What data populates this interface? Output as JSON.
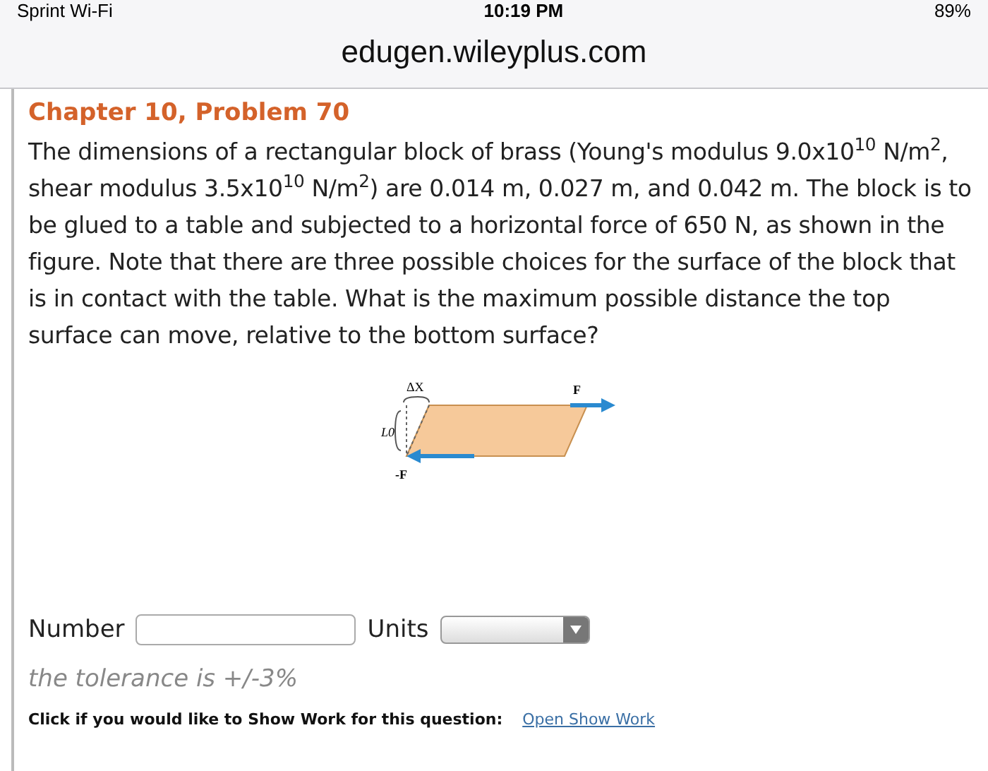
{
  "status_bar": {
    "carrier": "Sprint Wi-Fi",
    "time": "10:19 PM",
    "battery": "89%"
  },
  "address_bar": {
    "url": "edugen.wileyplus.com"
  },
  "problem": {
    "title": "Chapter 10, Problem 70",
    "text": "The dimensions of a rectangular block of brass (Young's modulus 9.0x10$^{10}$ N/m$^{2}$, shear modulus 3.5x10$^{10}$ N/m$^{2}$) are 0.014 m, 0.027 m, and 0.042 m. The block is to be glued to a table and subjected to a horizontal force of 650 N, as shown in the figure. Note that there are three possible choices for the surface of the block that is in contact with the table. What is the maximum possible distance the top surface can move, relative to the bottom surface?",
    "figure": {
      "labels": [
        "ΔX",
        "F",
        "L0",
        "-F"
      ]
    }
  },
  "answer": {
    "number_label": "Number",
    "units_label": "Units",
    "tolerance": "the tolerance is +/-3%"
  },
  "show_work": {
    "prompt": "Click if you would like to Show Work for this question:",
    "link": "Open Show Work"
  }
}
